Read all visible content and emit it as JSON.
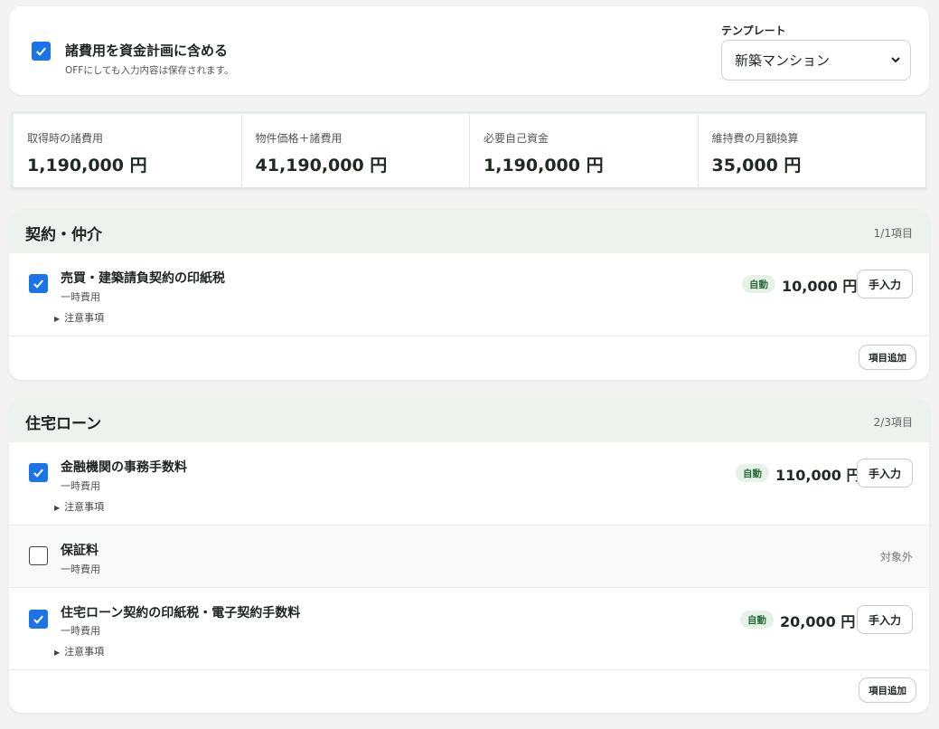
{
  "settings": {
    "include_label": "諸費用を資金計画に含める",
    "include_note": "OFFにしても入力内容は保存されます。",
    "include_checked": true,
    "template_label": "テンプレート",
    "template_value": "新築マンション"
  },
  "summary": [
    {
      "label": "取得時の諸費用",
      "value": "1,190,000 円"
    },
    {
      "label": "物件価格＋諸費用",
      "value": "41,190,000 円"
    },
    {
      "label": "必要自己資金",
      "value": "1,190,000 円"
    },
    {
      "label": "維持費の月額換算",
      "value": "35,000 円"
    }
  ],
  "sections": [
    {
      "title": "契約・仲介",
      "count": "1/1項目",
      "add_label": "項目追加",
      "items": [
        {
          "title": "売買・建築請負契約の印紙税",
          "type": "一時費用",
          "note": "注意事項",
          "badge": "自動",
          "amount": "10,000 円",
          "button": "手入力",
          "checked": true
        }
      ]
    },
    {
      "title": "住宅ローン",
      "count": "2/3項目",
      "add_label": "項目追加",
      "items": [
        {
          "title": "金融機関の事務手数料",
          "type": "一時費用",
          "note": "注意事項",
          "badge": "自動",
          "amount": "110,000 円",
          "button": "手入力",
          "checked": true
        },
        {
          "title": "保証料",
          "type": "一時費用",
          "status": "対象外",
          "checked": false
        },
        {
          "title": "住宅ローン契約の印紙税・電子契約手数料",
          "type": "一時費用",
          "note": "注意事項",
          "badge": "自動",
          "amount": "20,000 円",
          "button": "手入力",
          "checked": true
        }
      ]
    }
  ],
  "colors": {
    "accent": "#1a73e8",
    "section_bg": "#edf2ee",
    "badge_bg": "#e6f2e8",
    "badge_text": "#2b6e3c"
  }
}
